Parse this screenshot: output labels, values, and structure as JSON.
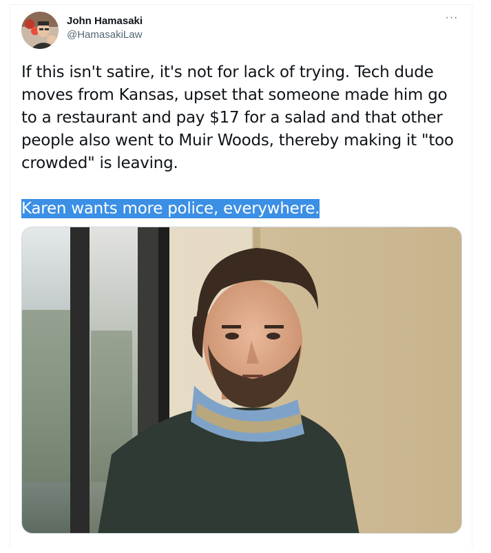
{
  "tweet": {
    "author": {
      "display_name": "John Hamasaki",
      "handle": "@HamasakiLaw",
      "avatar_icon": "profile-photo"
    },
    "more_icon": "ellipsis-icon",
    "more_label": "···",
    "body_paragraphs": [
      "If this isn't satire, it's not for lack of trying. Tech dude moves from Kansas, upset that someone made him go to a restaurant and pay $17 for a salad and that other people also went to Muir Woods, thereby making it \"too crowded\" is leaving."
    ],
    "highlighted_text": "Karen wants more police, everywhere.",
    "highlight_color": "#3b8fe5",
    "media": {
      "type": "photo"
    }
  },
  "colors": {
    "text_primary": "#0f1419",
    "text_secondary": "#536471",
    "border": "#cfd9de"
  }
}
